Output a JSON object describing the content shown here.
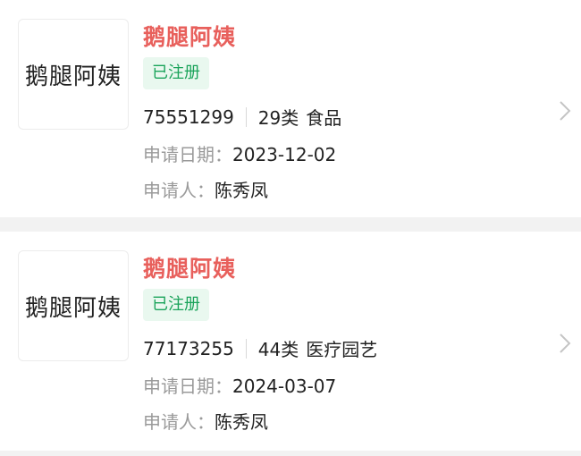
{
  "items": [
    {
      "logo_text": "鹅腿阿姨",
      "name": "鹅腿阿姨",
      "status": "已注册",
      "reg_no": "75551299",
      "class_text": "29类",
      "class_name": "食品",
      "date_label": "申请日期：",
      "date": "2023-12-02",
      "applicant_label": "申请人：",
      "applicant": "陈秀凤",
      "arrow_icon": "chevron-right-icon"
    },
    {
      "logo_text": "鹅腿阿姨",
      "name": "鹅腿阿姨",
      "status": "已注册",
      "reg_no": "77173255",
      "class_text": "44类",
      "class_name": "医疗园艺",
      "date_label": "申请日期：",
      "date": "2024-03-07",
      "applicant_label": "申请人：",
      "applicant": "陈秀凤",
      "arrow_icon": "chevron-right-icon"
    }
  ],
  "colors": {
    "name": "#e8605c",
    "badge_text": "#1aa35a",
    "badge_bg": "#e9f8ef",
    "label": "#9a9a9a",
    "page_bg": "#f2f2f2"
  }
}
